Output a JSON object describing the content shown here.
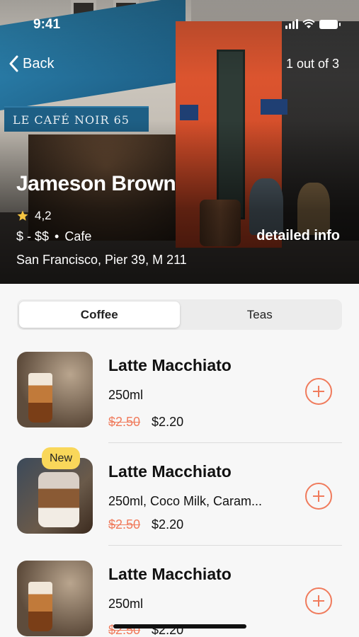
{
  "status_bar": {
    "time": "9:41"
  },
  "nav": {
    "back_label": "Back",
    "pager": "1 out of 3"
  },
  "place": {
    "name": "Jameson Brown",
    "rating": "4,2",
    "price_range": "$ - $$",
    "separator": "•",
    "category": "Cafe",
    "address": "San Francisco, Pier 39, M 211",
    "details_label": "detailed info",
    "awning_text": "LE CAFÉ NOIR 65"
  },
  "tabs": [
    {
      "label": "Coffee",
      "active": true
    },
    {
      "label": "Teas",
      "active": false
    }
  ],
  "menu": [
    {
      "name": "Latte Macchiato",
      "desc": "250ml",
      "old_price": "$2.50",
      "price": "$2.20",
      "badge": ""
    },
    {
      "name": "Latte Macchiato",
      "desc": "250ml, Coco Milk, Caram...",
      "old_price": "$2.50",
      "price": "$2.20",
      "badge": "New"
    },
    {
      "name": "Latte Macchiato",
      "desc": "250ml",
      "old_price": "$2.50",
      "price": "$2.20",
      "badge": ""
    }
  ],
  "colors": {
    "accent": "#f07b5c",
    "badge": "#f9d75a",
    "star": "#f5c542"
  }
}
